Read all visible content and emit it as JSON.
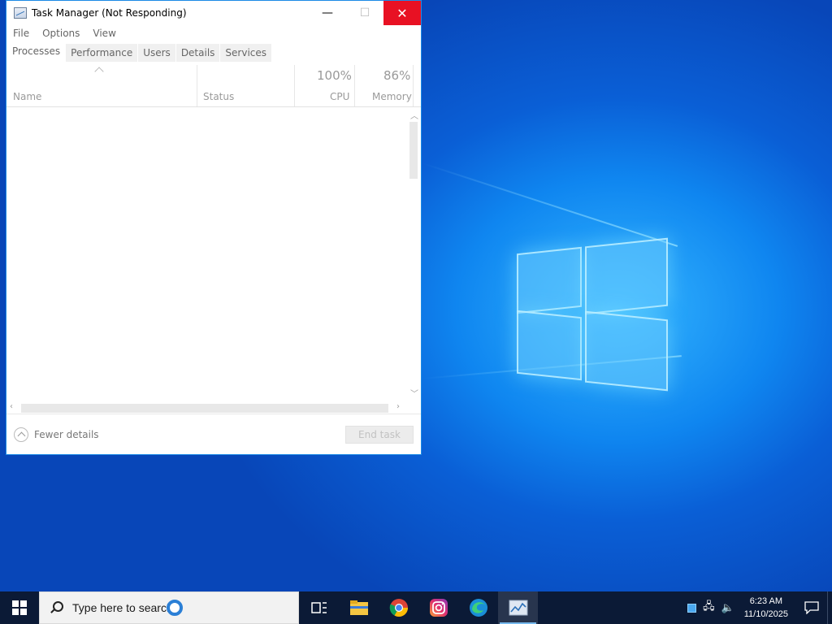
{
  "window": {
    "title": "Task Manager (Not Responding)",
    "controls": {
      "minimize": "—",
      "maximize": "☐",
      "close": "✕"
    }
  },
  "menu": [
    "File",
    "Options",
    "View"
  ],
  "tabs": [
    "Processes",
    "Performance",
    "Users",
    "Details",
    "Services"
  ],
  "columns": {
    "name": "Name",
    "status": "Status",
    "cpu": {
      "label": "CPU",
      "percent": "100%"
    },
    "memory": {
      "label": "Memory",
      "percent": "86%"
    }
  },
  "footer": {
    "fewer_details": "Fewer details",
    "end_task": "End task"
  },
  "taskbar": {
    "search_placeholder": "Type here to search",
    "clock_time": "6:23 AM",
    "clock_date": "11/10/2025"
  },
  "colors": {
    "close_button": "#e81123",
    "taskbar": "#0b1a36",
    "accent": "#1b8ae6"
  }
}
